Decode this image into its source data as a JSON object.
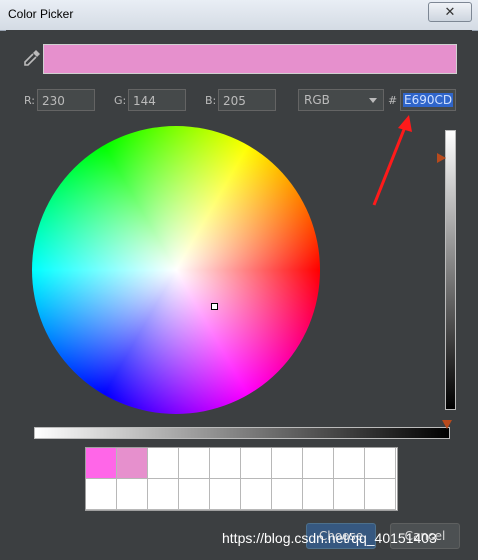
{
  "window": {
    "title": "Color Picker",
    "close_glyph": "✕"
  },
  "preview_color": "#E690CD",
  "rgb": {
    "r_label": "R:",
    "r_value": "230",
    "g_label": "G:",
    "g_value": "144",
    "b_label": "B:",
    "b_value": "205"
  },
  "mode_select": {
    "selected": "RGB"
  },
  "hex": {
    "prefix": "#",
    "value": "E690CD"
  },
  "icons": {
    "eyedropper": "eyedropper-icon",
    "mode_caret": "chevron-down-icon"
  },
  "slider_colors": {
    "thumb": "#b84a1c"
  },
  "recent_colors": [
    "#ff66e8",
    "#e690cd",
    "",
    "",
    "",
    "",
    "",
    "",
    "",
    "",
    "",
    "",
    "",
    "",
    "",
    "",
    "",
    "",
    "",
    ""
  ],
  "buttons": {
    "choose": "Choose",
    "cancel": "Cancel"
  },
  "annotation": {
    "arrow_color": "#ff1a1a"
  },
  "watermark": "https://blog.csdn.net/qq_40151403"
}
